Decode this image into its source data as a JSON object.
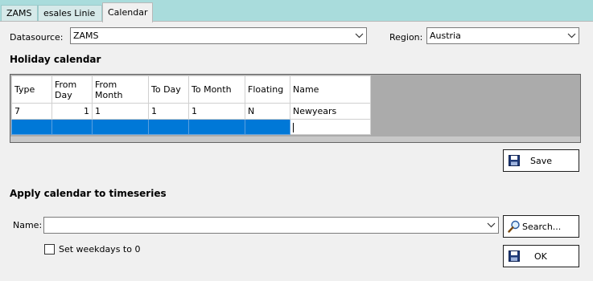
{
  "tabs": [
    {
      "label": "ZAMS"
    },
    {
      "label": "esales Linie"
    },
    {
      "label": "Calendar"
    }
  ],
  "datasource": {
    "label": "Datasource:",
    "value": "ZAMS"
  },
  "region": {
    "label": "Region:",
    "value": "Austria"
  },
  "holiday": {
    "heading": "Holiday calendar",
    "columns": [
      "Type",
      "From Day",
      "From Month",
      "To Day",
      "To Month",
      "Floating",
      "Name"
    ],
    "rows": [
      {
        "type": "7",
        "from_day": "1",
        "from_month": "1",
        "to_day": "1",
        "to_month": "1",
        "floating": "N",
        "name": "Newyears"
      }
    ]
  },
  "save_button": {
    "label": "Save",
    "icon": "floppy-disk-icon"
  },
  "apply": {
    "heading": "Apply calendar to timeseries",
    "name_label": "Name:",
    "name_value": "",
    "search_label": "Search...",
    "search_icon": "magnifier-icon",
    "weekdays_label": "Set weekdays to 0",
    "weekdays_checked": false,
    "ok_label": "OK",
    "ok_icon": "floppy-disk-icon"
  },
  "colors": {
    "window_bg": "#a9dcdc",
    "panel_bg": "#f0f0f0",
    "selection": "#0078d7",
    "grid_bg": "#ababab"
  }
}
